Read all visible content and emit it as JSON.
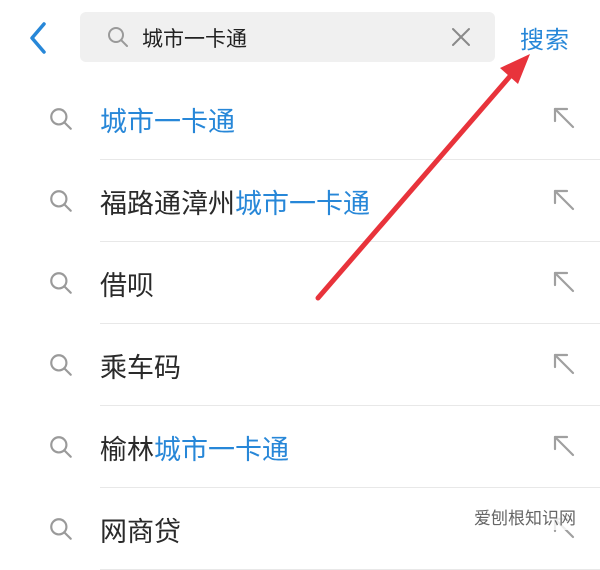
{
  "search": {
    "query": "城市一卡通",
    "submit_label": "搜索"
  },
  "suggestions": [
    {
      "prefix": "",
      "highlight": "城市一卡通",
      "suffix": ""
    },
    {
      "prefix": "福路通漳州",
      "highlight": "城市一卡通",
      "suffix": ""
    },
    {
      "prefix": "借呗",
      "highlight": "",
      "suffix": ""
    },
    {
      "prefix": "乘车码",
      "highlight": "",
      "suffix": ""
    },
    {
      "prefix": "榆林",
      "highlight": "城市一卡通",
      "suffix": ""
    },
    {
      "prefix": "网商贷",
      "highlight": "",
      "suffix": ""
    }
  ],
  "icons": {
    "back": "chevron-left-icon",
    "search": "search-icon",
    "clear": "close-icon",
    "fill_query": "arrow-up-left-icon"
  },
  "colors": {
    "accent": "#2787d8",
    "annotation_arrow": "#e8333b",
    "text": "#2a2a2a",
    "icon_gray": "#9a9a9a"
  },
  "watermark": "爱刨根知识网"
}
